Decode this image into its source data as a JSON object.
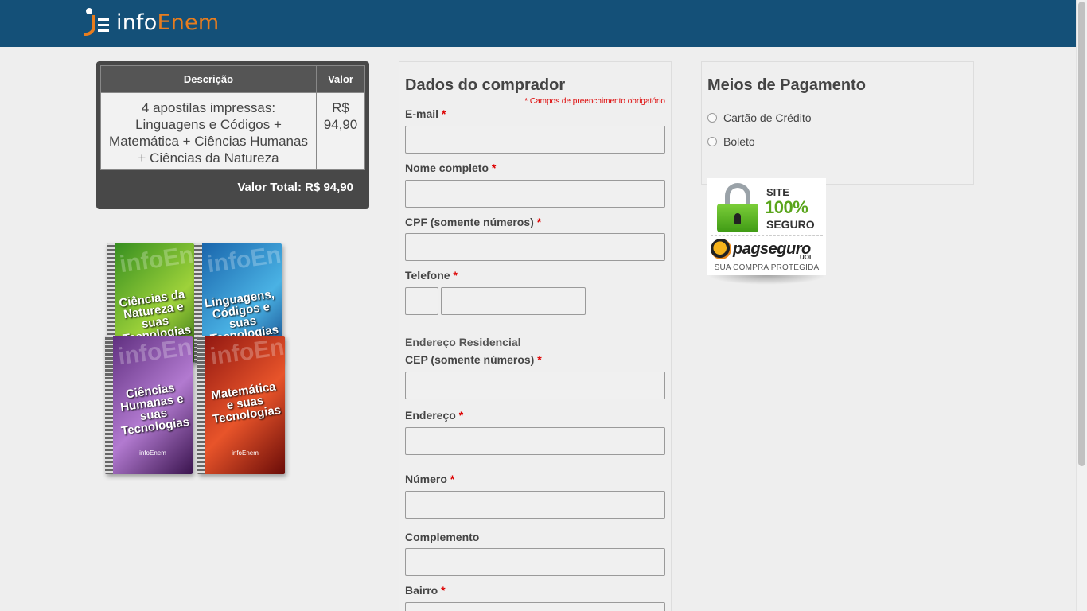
{
  "header": {
    "logo_info": "info",
    "logo_enem": "Enem",
    "bg_color": "#145078",
    "accent_color": "#e87d1e"
  },
  "order": {
    "col_description": "Descrição",
    "col_value": "Valor",
    "item_description": "4 apostilas impressas: Linguagens e Códigos + Matemática + Ciências Humanas + Ciências da Natureza",
    "item_value": "R$ 94,90",
    "total": "Valor Total: R$ 94,90"
  },
  "books": [
    {
      "title": "Ciências da Natureza e suas Tecnologias"
    },
    {
      "title": "Linguagens, Códigos e suas Tecnologias"
    },
    {
      "title": "Ciências Humanas e suas Tecnologias"
    },
    {
      "title": "Matemática e suas Tecnologias"
    }
  ],
  "books_brand": "infoEnem",
  "buyer": {
    "title": "Dados do comprador",
    "required_note": "* Campos de preenchimento obrigatório",
    "email_label": "E-mail",
    "name_label": "Nome completo",
    "cpf_label": "CPF (somente números)",
    "phone_label": "Telefone",
    "address_section": "Endereço Residencial",
    "cep_label": "CEP (somente números)",
    "address_label": "Endereço",
    "number_label": "Número",
    "complement_label": "Complemento",
    "district_label": "Bairro",
    "required_mark": "*"
  },
  "payment": {
    "title": "Meios de Pagamento",
    "options": [
      "Cartão de Crédito",
      "Boleto"
    ]
  },
  "badge": {
    "site": "SITE",
    "percent": "100%",
    "seguro": "SEGURO",
    "brand": "pagseguro",
    "uol": "UOL",
    "protected": "SUA COMPRA PROTEGIDA"
  }
}
